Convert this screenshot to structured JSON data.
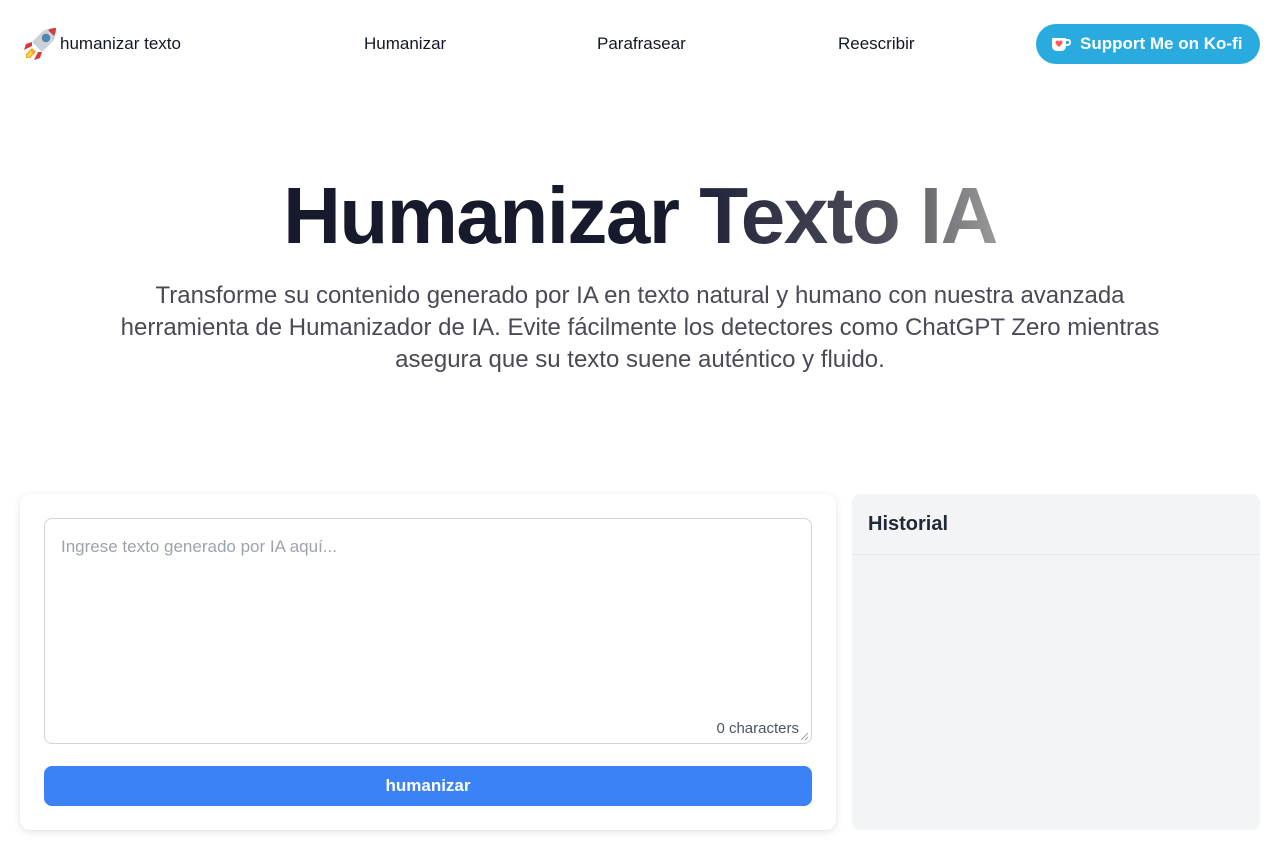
{
  "nav": {
    "logo_text": "humanizar texto",
    "links": [
      "Humanizar",
      "Parafrasear",
      "Reescribir"
    ],
    "kofi_label": "Support Me on Ko-fi"
  },
  "hero": {
    "title_part1": "Humanizar ",
    "title_part2": "Texto IA",
    "subtitle": "Transforme su contenido generado por IA en texto natural y humano con nuestra avanzada herramienta de Humanizador de IA. Evite fácilmente los detectores como ChatGPT Zero mientras asegura que su texto suene auténtico y fluido."
  },
  "editor": {
    "placeholder": "Ingrese texto generado por IA aquí...",
    "value": "",
    "char_count": "0 characters",
    "button_label": "humanizar"
  },
  "history": {
    "title": "Historial"
  },
  "colors": {
    "accent": "#3b82f6",
    "kofi": "#29abe0",
    "panel": "#f3f4f6"
  }
}
